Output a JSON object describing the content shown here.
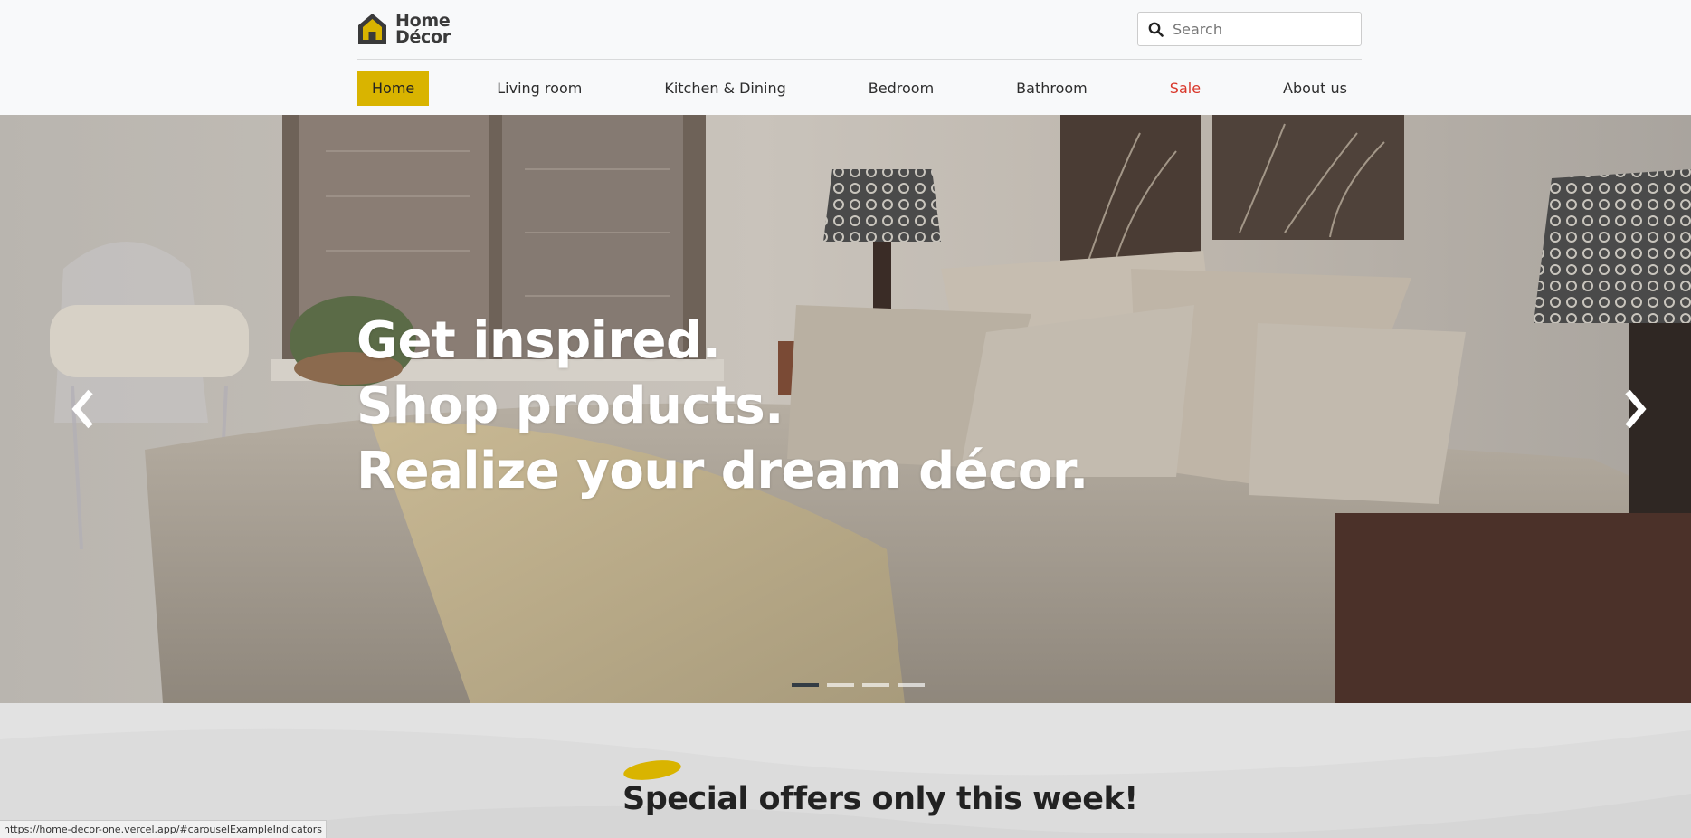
{
  "brand": {
    "line1": "Home",
    "line2": "Décor",
    "accent_color": "#d9b400"
  },
  "search": {
    "placeholder": "Search"
  },
  "nav": {
    "items": [
      {
        "label": "Home",
        "active": true
      },
      {
        "label": "Living room"
      },
      {
        "label": "Kitchen & Dining"
      },
      {
        "label": "Bedroom"
      },
      {
        "label": "Bathroom"
      },
      {
        "label": "Sale",
        "color": "#d9372a"
      },
      {
        "label": "About us"
      }
    ]
  },
  "hero": {
    "lines": [
      "Get inspired.",
      "Shop products.",
      "Realize your dream décor."
    ],
    "slide_count": 4,
    "active_slide": 1,
    "prev_icon": "chevron-left-icon",
    "next_icon": "chevron-right-icon"
  },
  "offers": {
    "title": "Special offers only this week!"
  },
  "status_bar": {
    "url": "https://home-decor-one.vercel.app/#carouselExampleIndicators"
  }
}
